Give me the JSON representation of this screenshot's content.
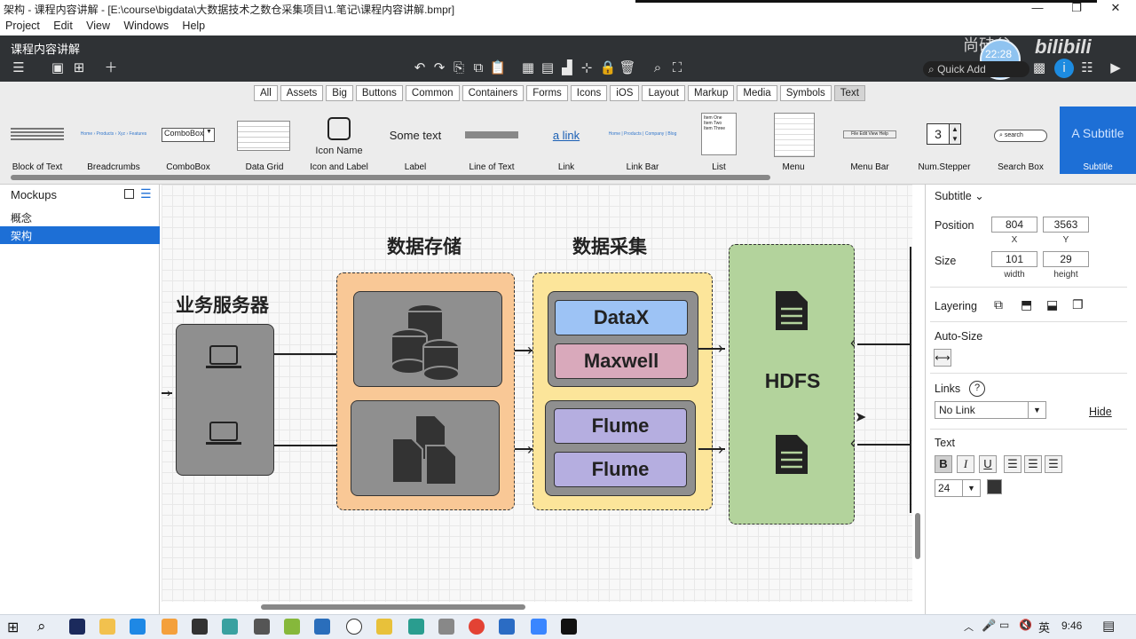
{
  "window": {
    "title": "架构 - 课程内容讲解 - [E:\\course\\bigdata\\大数据技术之数仓采集项目\\1.笔记\\课程内容讲解.bmpr]",
    "minimize": "—",
    "restore": "❐",
    "close": "✕"
  },
  "menu": [
    "Project",
    "Edit",
    "View",
    "Windows",
    "Help"
  ],
  "project_tab": "课程内容讲解",
  "toolbar": {
    "quick_add_placeholder": "Quick Add",
    "overlay_time": "22:28"
  },
  "filters": [
    "All",
    "Assets",
    "Big",
    "Buttons",
    "Common",
    "Containers",
    "Forms",
    "Icons",
    "iOS",
    "Layout",
    "Markup",
    "Media",
    "Symbols",
    "Text"
  ],
  "filter_selected": "Text",
  "library": [
    {
      "label": "Block of Text"
    },
    {
      "label": "Breadcrumbs",
      "preview": "Home › Products › Xyz › Features"
    },
    {
      "label": "ComboBox",
      "preview": "ComboBox"
    },
    {
      "label": "Data Grid"
    },
    {
      "label": "Icon and Label",
      "preview": "Icon Name"
    },
    {
      "label": "Label",
      "preview": "Some text"
    },
    {
      "label": "Line of Text"
    },
    {
      "label": "Link",
      "preview": "a link"
    },
    {
      "label": "Link Bar",
      "preview": "Home | Products | Company | Blog"
    },
    {
      "label": "List",
      "preview": "Item One\nItem Two\nItem Three"
    },
    {
      "label": "Menu"
    },
    {
      "label": "Menu Bar",
      "preview": "File Edit View Help"
    },
    {
      "label": "Num.Stepper",
      "preview": "3"
    },
    {
      "label": "Search Box",
      "preview": "search"
    },
    {
      "label": "Subtitle",
      "preview": "A Subtitle"
    }
  ],
  "sidebar": {
    "title": "Mockups",
    "items": [
      "概念",
      "架构"
    ],
    "selected": "架构"
  },
  "diagram": {
    "headings": {
      "server": "业务服务器",
      "storage": "数据存储",
      "collect": "数据采集"
    },
    "tools": [
      "DataX",
      "Maxwell",
      "Flume",
      "Flume"
    ],
    "hdfs": "HDFS",
    "colors": {
      "storage": "#f9c896",
      "collect": "#fce59a",
      "hdfs": "#b3d39c",
      "datax": "#9dc3f5",
      "maxwell": "#d9a9bb",
      "flume": "#b5aee0",
      "gray": "#8f8f8f"
    }
  },
  "inspector": {
    "type": "Subtitle",
    "position_label": "Position",
    "x": "804",
    "y": "3563",
    "x_label": "X",
    "y_label": "Y",
    "size_label": "Size",
    "width": "101",
    "height": "29",
    "width_label": "width",
    "height_label": "height",
    "layering_label": "Layering",
    "autosize_label": "Auto-Size",
    "links_label": "Links",
    "links_help": "?",
    "link_value": "No Link",
    "hide_label": "Hide",
    "text_label": "Text",
    "bold": "B",
    "italic": "I",
    "underline": "U",
    "font_size": "24",
    "color_swatch": "#333333"
  },
  "taskbar": {
    "ime": "英",
    "time": "9:46"
  }
}
